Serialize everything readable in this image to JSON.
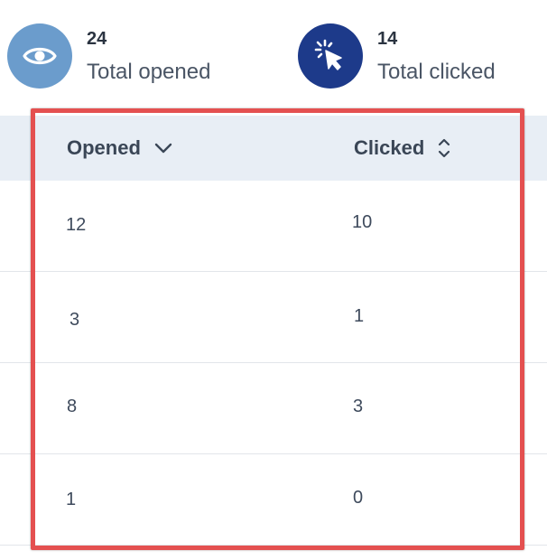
{
  "stats": {
    "opened": {
      "value": "24",
      "label": "Total opened",
      "icon": "eye-icon",
      "color": "#6b9ccc"
    },
    "clicked": {
      "value": "14",
      "label": "Total clicked",
      "icon": "cursor-click-icon",
      "color": "#1d3a8a"
    }
  },
  "table": {
    "columns": [
      {
        "label": "Opened",
        "sort": "chevron-down-icon"
      },
      {
        "label": "Clicked",
        "sort": "sort-updown-icon"
      }
    ],
    "rows": [
      {
        "opened": "12",
        "clicked": "10"
      },
      {
        "opened": "3",
        "clicked": "1"
      },
      {
        "opened": "8",
        "clicked": "3"
      },
      {
        "opened": "1",
        "clicked": "0"
      }
    ]
  },
  "colors": {
    "header_bg": "#e8eef5",
    "highlight_border": "#e45050",
    "text": "#3e4a5c"
  }
}
